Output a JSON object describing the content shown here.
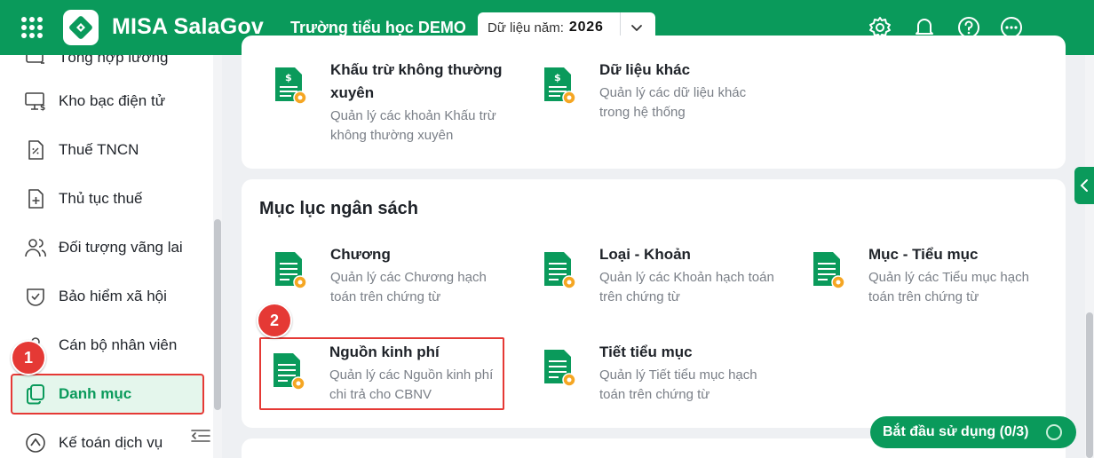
{
  "header": {
    "app_title": "MISA SalaGov",
    "school": "Trường tiểu học DEMO",
    "year_label": "Dữ liệu năm:",
    "year_value": "2026"
  },
  "sidebar": {
    "items": [
      {
        "label": "Tổng hợp lương",
        "icon": "payroll-icon"
      },
      {
        "label": "Kho bạc điện tử",
        "icon": "monitor-money-icon"
      },
      {
        "label": "Thuế TNCN",
        "icon": "tax-document-icon"
      },
      {
        "label": "Thủ tục thuế",
        "icon": "document-plus-icon"
      },
      {
        "label": "Đối tượng vãng lai",
        "icon": "users-icon"
      },
      {
        "label": "Bảo hiểm xã hội",
        "icon": "shield-icon"
      },
      {
        "label": "Cán bộ nhân viên",
        "icon": "staff-icon"
      },
      {
        "label": "Danh mục",
        "icon": "catalog-icon",
        "active": true
      },
      {
        "label": "Kế toán dịch vụ",
        "icon": "service-icon"
      }
    ]
  },
  "badges": {
    "one": "1",
    "two": "2"
  },
  "top_card": {
    "tiles": [
      {
        "title": "Khấu trừ không thường xuyên",
        "desc": "Quản lý các khoản Khấu trừ không thường xuyên"
      },
      {
        "title": "Dữ liệu khác",
        "desc": "Quản lý các dữ liệu khác trong hệ thống"
      }
    ]
  },
  "budget_section": {
    "title": "Mục lục ngân sách",
    "tiles": [
      {
        "title": "Chương",
        "desc": "Quản lý các Chương hạch toán trên chứng từ"
      },
      {
        "title": "Loại - Khoản",
        "desc": "Quản lý các Khoản hạch toán trên chứng từ"
      },
      {
        "title": "Mục - Tiểu mục",
        "desc": "Quản lý các Tiểu mục hạch toán trên chứng từ"
      },
      {
        "title": "Nguồn kinh phí",
        "desc": "Quản lý các Nguồn kinh phí chi trả cho CBNV"
      },
      {
        "title": "Tiết tiểu mục",
        "desc": "Quản lý Tiết tiểu mục hạch toán trên chứng từ"
      }
    ]
  },
  "start_button": {
    "label": "Bắt đầu sử dụng (0/3)"
  },
  "colors": {
    "brand": "#0a9a5b",
    "highlight": "#e53935",
    "tile_icon": "#0a9a5b",
    "gear": "#f5a623"
  }
}
